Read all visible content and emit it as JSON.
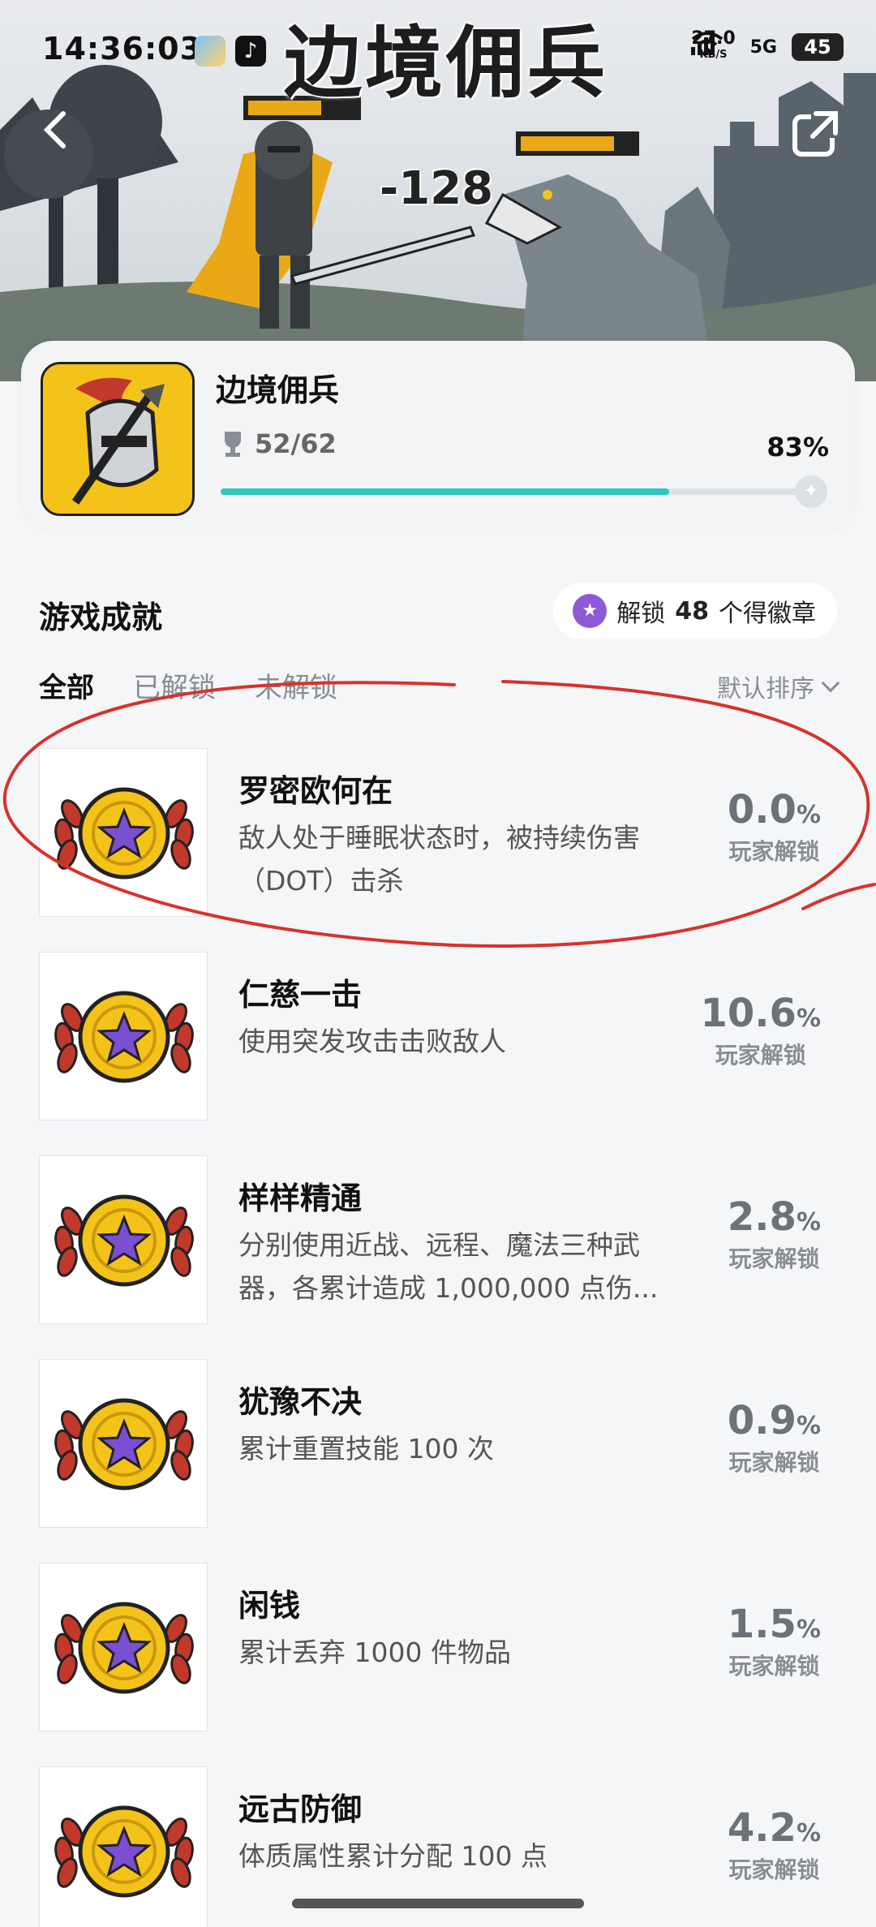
{
  "status_bar": {
    "time": "14:36:03",
    "speed_value": "27.0",
    "speed_unit": "KB/S",
    "network": "5G",
    "battery": "45"
  },
  "banner": {
    "title": "边境佣兵",
    "damage_text": "-128"
  },
  "game": {
    "name": "边境佣兵",
    "trophy_count": "52/62",
    "percent": "83%",
    "progress": 0.83
  },
  "section": {
    "title": "游戏成就",
    "badge_prefix": "解锁",
    "badge_count": "48",
    "badge_suffix": "个得徽章"
  },
  "tabs": [
    {
      "label": "全部",
      "active": true
    },
    {
      "label": "已解锁",
      "active": false
    },
    {
      "label": "未解锁",
      "active": false
    }
  ],
  "sort_label": "默认排序",
  "rate_suffix": "%",
  "rate_label": "玩家解锁",
  "achievements": [
    {
      "title": "罗密欧何在",
      "desc": "敌人处于睡眠状态时，被持续伤害（DOT）击杀",
      "rate": "0.0"
    },
    {
      "title": "仁慈一击",
      "desc": "使用突发攻击击败敌人",
      "rate": "10.6"
    },
    {
      "title": "样样精通",
      "desc": "分别使用近战、远程、魔法三种武器，各累计造成 1,000,000 点伤...",
      "rate": "2.8"
    },
    {
      "title": "犹豫不决",
      "desc": "累计重置技能 100 次",
      "rate": "0.9"
    },
    {
      "title": "闲钱",
      "desc": "累计丢弃 1000 件物品",
      "rate": "1.5"
    },
    {
      "title": "远古防御",
      "desc": "体质属性累计分配 100 点",
      "rate": "4.2"
    }
  ],
  "colors": {
    "accent": "#2fc8bd",
    "annotation": "#d8322c",
    "medal_gold": "#f4c31a",
    "medal_star": "#7b4fd1",
    "laurel_red": "#c0392b"
  }
}
